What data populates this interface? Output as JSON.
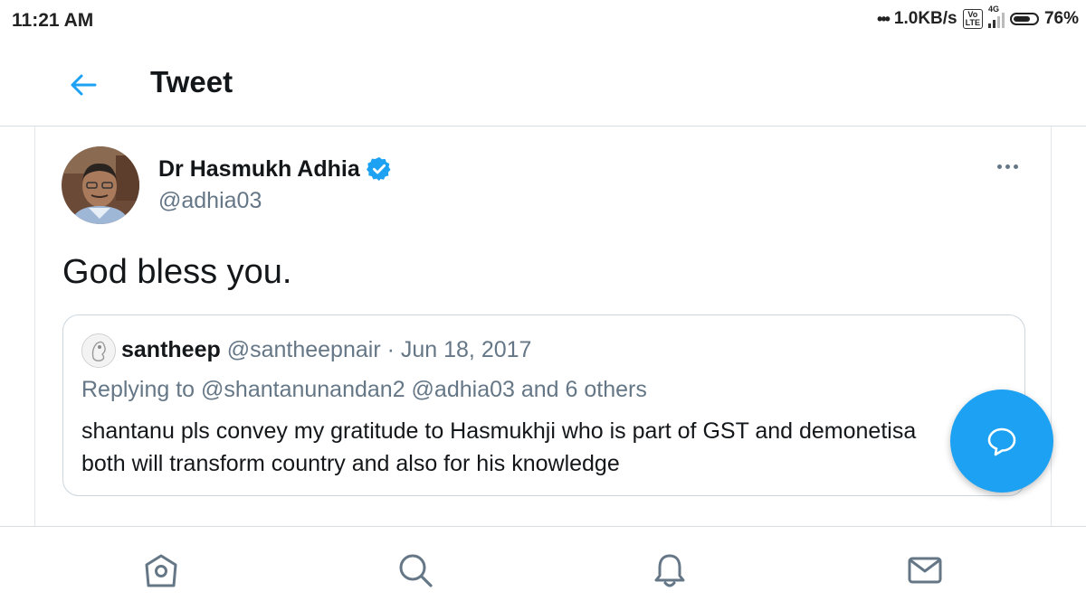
{
  "status_bar": {
    "time": "11:21 AM",
    "network_speed": "1.0KB/s",
    "volte_label": "Vo\nLTE",
    "signal_label": "4G",
    "battery_percent": "76%",
    "battery_level": 0.76
  },
  "header": {
    "back_icon": "arrow-left-icon",
    "title": "Tweet"
  },
  "tweet": {
    "author_name": "Dr Hasmukh Adhia",
    "author_handle": "@adhia03",
    "verified": true,
    "text": "God bless you.",
    "more_icon": "more-horizontal-icon"
  },
  "quoted_tweet": {
    "author_name": "santheep",
    "author_handle": "@santheepnair",
    "separator": " · ",
    "date": "Jun 18, 2017",
    "replying_to_prefix": "Replying to ",
    "replying_to_users": "@shantanunandan2 @adhia03",
    "replying_to_suffix": " and 6 others",
    "body_line1": "shantanu pls convey my gratitude to Hasmukhji who is part of GST and demonetisa",
    "body_line2": "both will transform country and also for his knowledge"
  },
  "fab": {
    "icon": "compose-reply-icon"
  },
  "bottom_nav": {
    "items": [
      {
        "icon": "home-icon"
      },
      {
        "icon": "search-icon"
      },
      {
        "icon": "notifications-icon"
      },
      {
        "icon": "messages-icon"
      }
    ]
  },
  "colors": {
    "accent": "#1da1f2",
    "secondary_text": "#657786",
    "primary_text": "#14171a",
    "border": "#ccd6dd"
  }
}
